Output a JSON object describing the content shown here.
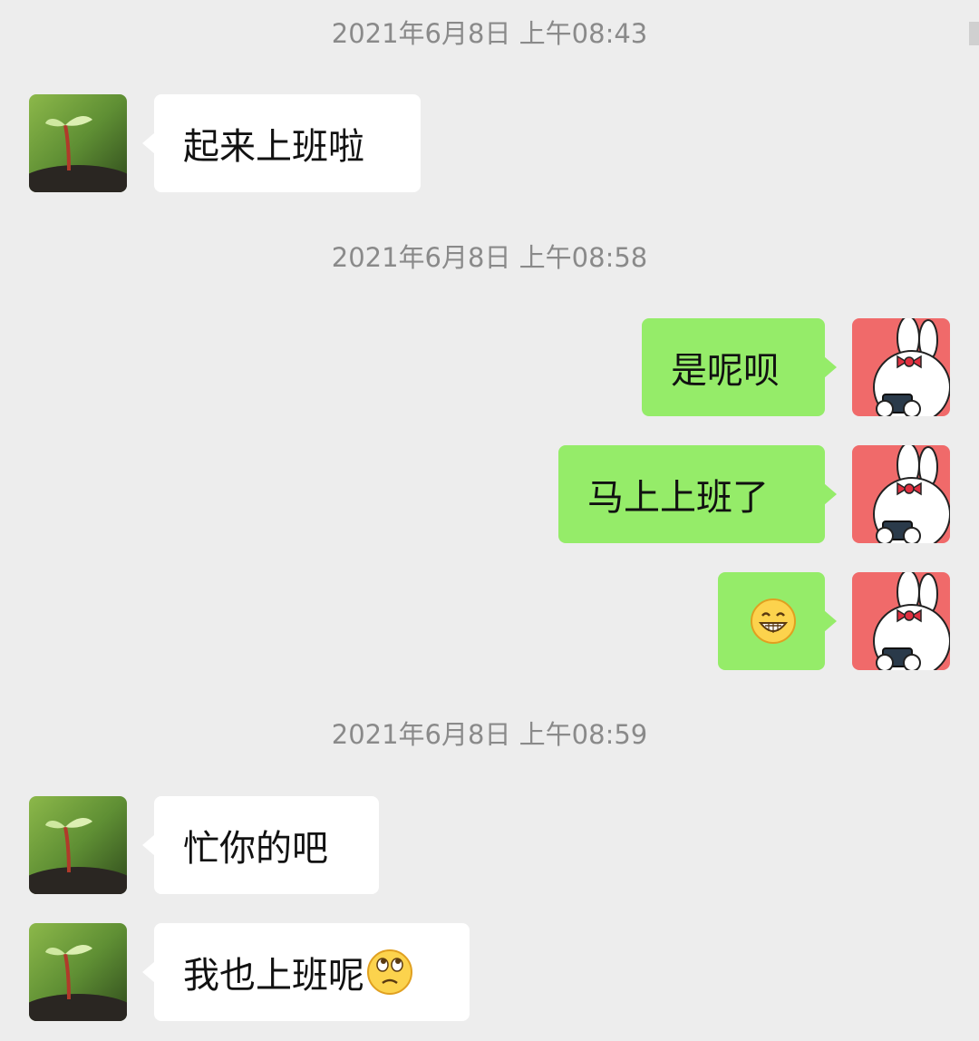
{
  "timestamps": [
    "2021年6月8日 上午08:43",
    "2021年6月8日 上午08:58",
    "2021年6月8日 上午08:59"
  ],
  "messages": [
    {
      "side": "left",
      "text": "起来上班啦",
      "avatar": "seedling-avatar"
    },
    {
      "side": "right",
      "text": "是呢呗",
      "avatar": "bunny-avatar"
    },
    {
      "side": "right",
      "text": "马上上班了",
      "avatar": "bunny-avatar"
    },
    {
      "side": "right",
      "text": "",
      "avatar": "bunny-avatar",
      "emoji": "grinning-face-icon"
    },
    {
      "side": "left",
      "text": "忙你的吧",
      "avatar": "seedling-avatar"
    },
    {
      "side": "left",
      "text": "我也上班呢",
      "avatar": "seedling-avatar",
      "emoji": "eye-roll-face-icon"
    }
  ],
  "colors": {
    "background": "#ededed",
    "bubble_left": "#ffffff",
    "bubble_right": "#95ec69",
    "timestamp_text": "#8a8a8a",
    "bunny_avatar_bg": "#f06a6a"
  }
}
